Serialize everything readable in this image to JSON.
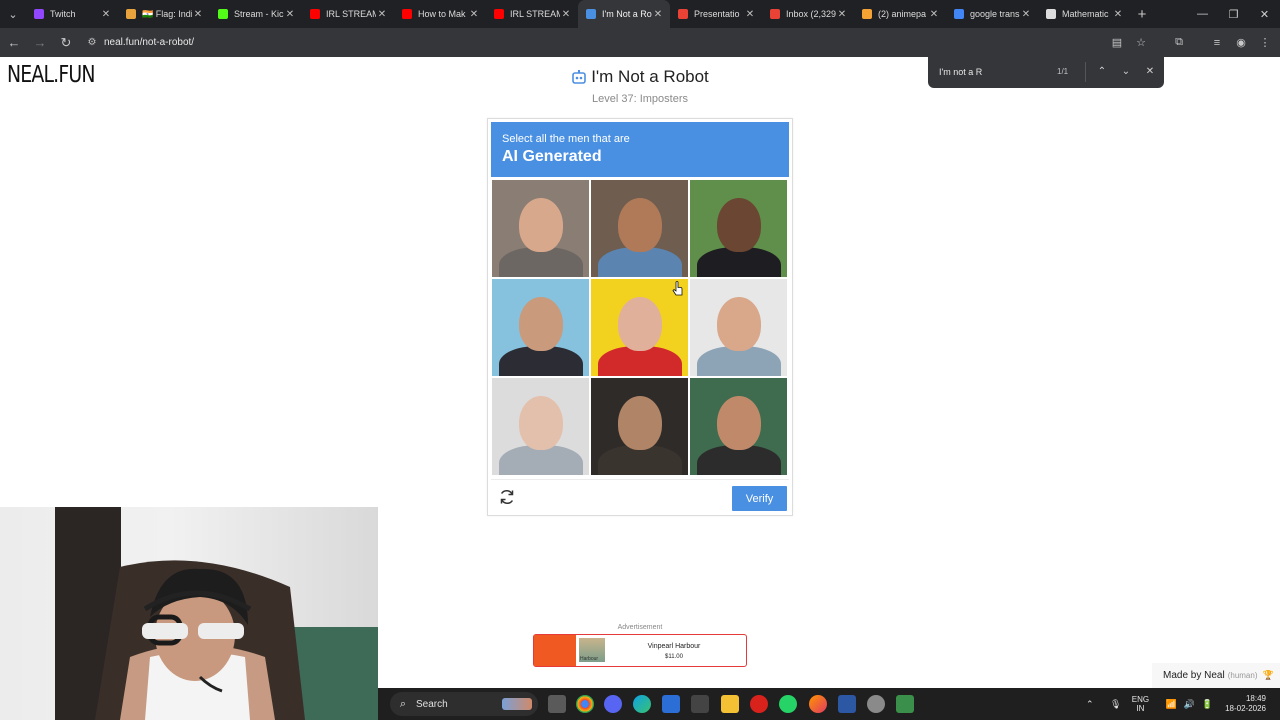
{
  "browser": {
    "tabs": [
      {
        "title": "Twitch",
        "color": "#9146ff"
      },
      {
        "title": "🇮🇳 Flag: India",
        "color": "#e8a33d"
      },
      {
        "title": "Stream - Kick",
        "color": "#53fc18"
      },
      {
        "title": "IRL STREAM (",
        "color": "#ff0000"
      },
      {
        "title": "How to Mak",
        "color": "#ff0000"
      },
      {
        "title": "IRL STREAM (",
        "color": "#ff0000"
      },
      {
        "title": "I'm Not a Ro",
        "color": "#4a90e2"
      },
      {
        "title": "Presentatio",
        "color": "#ea4335"
      },
      {
        "title": "Inbox (2,329",
        "color": "#ea4335"
      },
      {
        "title": "(2) animepa",
        "color": "#f3a233"
      },
      {
        "title": "google trans",
        "color": "#4285f4"
      },
      {
        "title": "Mathematic",
        "color": "#dddddd"
      }
    ],
    "active_tab": 6,
    "url": "neal.fun/not-a-robot/"
  },
  "find_bar": {
    "query": "I'm not a R",
    "count": "1/1"
  },
  "page": {
    "logo": "NEAL.FUN",
    "title": "I'm Not a Robot",
    "level": "Level 37: Imposters",
    "captcha": {
      "instruction": "Select all the men that are",
      "target": "AI Generated",
      "verify_label": "Verify",
      "tiles": [
        {
          "bg": "#8a7d73",
          "skin": "#d8a88c",
          "shirt": "#6d6764"
        },
        {
          "bg": "#6f5d4f",
          "skin": "#b07a58",
          "shirt": "#5b84b0"
        },
        {
          "bg": "#5f8f4a",
          "skin": "#6b4632",
          "shirt": "#1d1d22"
        },
        {
          "bg": "#86c2de",
          "skin": "#c99a7c",
          "shirt": "#2c2c34"
        },
        {
          "bg": "#f2d21f",
          "skin": "#e0b09a",
          "shirt": "#d22a2a"
        },
        {
          "bg": "#e7e7e7",
          "skin": "#d9a78a",
          "shirt": "#8da4b6"
        },
        {
          "bg": "#dcdcdc",
          "skin": "#e3c0ac",
          "shirt": "#a4acb5"
        },
        {
          "bg": "#2f2b29",
          "skin": "#b08466",
          "shirt": "#3a342f"
        },
        {
          "bg": "#3f6b4f",
          "skin": "#c08a6a",
          "shirt": "#2c2c2c"
        }
      ]
    },
    "ad": {
      "label": "Advertisement",
      "thumb_caption": "Harbour",
      "name": "Vinpearl Harbour",
      "price": "$11.00"
    },
    "made_by": "Made by Neal",
    "made_by_note": "(human)"
  },
  "taskbar": {
    "search_label": "Search",
    "lang_line1": "ENG",
    "lang_line2": "IN",
    "time": "18:49",
    "date": "18-02-2026"
  },
  "colors": {
    "accent": "#4a90e2",
    "chrome_dark": "#202124",
    "chrome_mid": "#35363a"
  }
}
